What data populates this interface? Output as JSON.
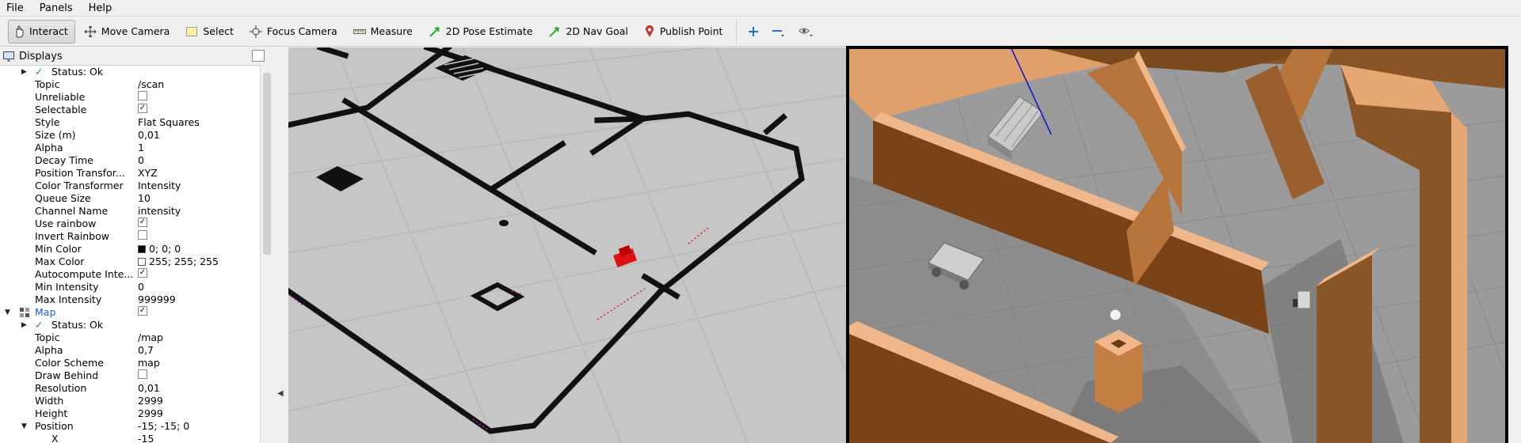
{
  "menu": [
    "File",
    "Panels",
    "Help"
  ],
  "toolbar": {
    "tools": [
      {
        "label": "Interact",
        "icon": "hand-icon",
        "active": true
      },
      {
        "label": "Move Camera",
        "icon": "move-camera-icon"
      },
      {
        "label": "Select",
        "icon": "select-icon"
      },
      {
        "label": "Focus Camera",
        "icon": "focus-camera-icon"
      },
      {
        "label": "Measure",
        "icon": "ruler-icon"
      },
      {
        "label": "2D Pose Estimate",
        "icon": "green-arrow-icon"
      },
      {
        "label": "2D Nav Goal",
        "icon": "green-arrow-icon"
      },
      {
        "label": "Publish Point",
        "icon": "map-pin-icon"
      }
    ],
    "extra_icons": [
      "plus-icon",
      "minus-icon",
      "eye-icon"
    ]
  },
  "displays": {
    "title": "Displays",
    "rows": [
      {
        "type": "status",
        "label": "Status: Ok"
      },
      {
        "key": "Topic",
        "value": "/scan"
      },
      {
        "key": "Unreliable",
        "check": false
      },
      {
        "key": "Selectable",
        "check": true
      },
      {
        "key": "Style",
        "value": "Flat Squares"
      },
      {
        "key": "Size (m)",
        "value": "0,01"
      },
      {
        "key": "Alpha",
        "value": "1"
      },
      {
        "key": "Decay Time",
        "value": "0"
      },
      {
        "key": "Position Transfor...",
        "value": "XYZ"
      },
      {
        "key": "Color Transformer",
        "value": "Intensity"
      },
      {
        "key": "Queue Size",
        "value": "10"
      },
      {
        "key": "Channel Name",
        "value": "intensity"
      },
      {
        "key": "Use rainbow",
        "check": true
      },
      {
        "key": "Invert Rainbow",
        "check": false
      },
      {
        "key": "Min Color",
        "value": "0; 0; 0",
        "swatch": "#000000"
      },
      {
        "key": "Max Color",
        "value": "255; 255; 255",
        "swatch": "#ffffff"
      },
      {
        "key": "Autocompute Inte...",
        "check": true
      },
      {
        "key": "Min Intensity",
        "value": "0"
      },
      {
        "key": "Max Intensity",
        "value": "999999"
      },
      {
        "type": "display",
        "label": "Map",
        "check": true
      },
      {
        "type": "status",
        "label": "Status: Ok"
      },
      {
        "key": "Topic",
        "value": "/map"
      },
      {
        "key": "Alpha",
        "value": "0,7"
      },
      {
        "key": "Color Scheme",
        "value": "map"
      },
      {
        "key": "Draw Behind",
        "check": false
      },
      {
        "key": "Resolution",
        "value": "0,01"
      },
      {
        "key": "Width",
        "value": "2999"
      },
      {
        "key": "Height",
        "value": "2999"
      },
      {
        "key": "Position",
        "value": "-15; -15; 0",
        "expanded": true
      },
      {
        "key": "X",
        "value": "-15",
        "indent": true
      }
    ]
  }
}
